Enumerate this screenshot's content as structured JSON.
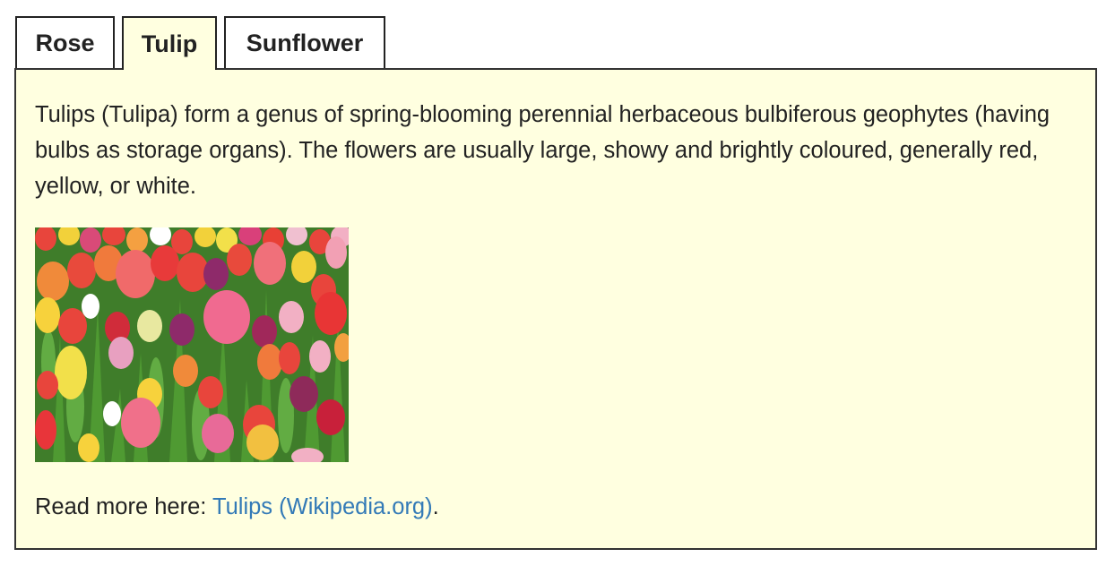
{
  "tabs": [
    {
      "label": "Rose",
      "active": false
    },
    {
      "label": "Tulip",
      "active": true
    },
    {
      "label": "Sunflower",
      "active": false
    }
  ],
  "panel": {
    "description": "Tulips (Tulipa) form a genus of spring-blooming perennial herbaceous bulbiferous geophytes (having bulbs as storage organs). The flowers are usually large, showy and brightly coloured, generally red, yellow, or white.",
    "image_alt": "tulip-field-photo",
    "read_more_prefix": "Read more here: ",
    "read_more_link": "Tulips (Wikipedia.org)",
    "read_more_suffix": "."
  },
  "colors": {
    "panel_background": "#ffffe0",
    "link": "#337ab7",
    "border": "#222222"
  }
}
